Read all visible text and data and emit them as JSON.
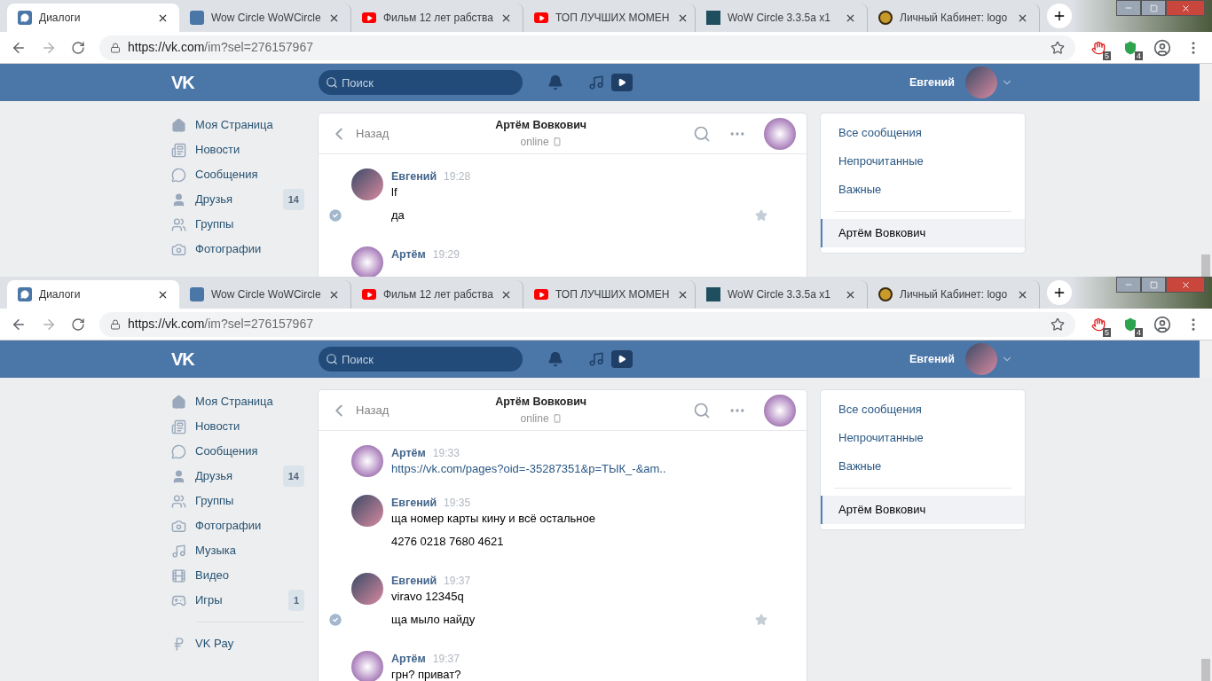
{
  "screens": [
    {
      "tabs": [
        {
          "label": "Диалоги",
          "selected": true
        },
        {
          "label": "Wow Circle WoWCircle",
          "selected": false
        },
        {
          "label": "Фильм 12 лет рабства",
          "selected": false
        },
        {
          "label": "ТОП ЛУЧШИХ МОМЕН",
          "selected": false
        },
        {
          "label": "WoW Circle 3.3.5a x1",
          "selected": false
        },
        {
          "label": "Личный Кабинет: logo",
          "selected": false
        }
      ],
      "address": {
        "host": "https://vk.com",
        "path": "/im?sel=276157967"
      },
      "extensions": [
        {
          "kind": "block",
          "badge": "5"
        },
        {
          "kind": "shield",
          "badge": "4"
        }
      ],
      "header": {
        "logo": "VK",
        "search_placeholder": "Поиск",
        "user": "Евгений"
      },
      "sidebar": [
        {
          "label": "Моя Страница"
        },
        {
          "label": "Новости"
        },
        {
          "label": "Сообщения"
        },
        {
          "label": "Друзья",
          "count": "14"
        },
        {
          "label": "Группы"
        },
        {
          "label": "Фотографии"
        }
      ],
      "dialog": {
        "back": "Назад",
        "title": "Артём Вовкович",
        "status": "online",
        "messages": [
          {
            "kind": "user",
            "author": "Евгений",
            "time": "19:28",
            "lines": [
              {
                "kind": "text",
                "text": "lf",
                "selected": false
              },
              {
                "kind": "text",
                "text": "да",
                "selected": true
              }
            ]
          },
          {
            "kind": "contact",
            "author": "Артём",
            "time": "19:29"
          }
        ]
      },
      "filters": [
        {
          "label": "Все сообщения",
          "selected": false
        },
        {
          "label": "Непрочитанные",
          "selected": false
        },
        {
          "label": "Важные",
          "selected": false
        },
        {
          "label": "Артём Вовкович",
          "selected": true
        }
      ]
    },
    {
      "tabs": [
        {
          "label": "Диалоги",
          "selected": true
        },
        {
          "label": "Wow Circle WoWCircle",
          "selected": false
        },
        {
          "label": "Фильм 12 лет рабства",
          "selected": false
        },
        {
          "label": "ТОП ЛУЧШИХ МОМЕН",
          "selected": false
        },
        {
          "label": "WoW Circle 3.3.5a x1",
          "selected": false
        },
        {
          "label": "Личный Кабинет: logo",
          "selected": false
        }
      ],
      "address": {
        "host": "https://vk.com",
        "path": "/im?sel=276157967"
      },
      "extensions": [
        {
          "kind": "block",
          "badge": "5"
        },
        {
          "kind": "shield",
          "badge": "4"
        }
      ],
      "header": {
        "logo": "VK",
        "search_placeholder": "Поиск",
        "user": "Евгений"
      },
      "sidebar": [
        {
          "label": "Моя Страница"
        },
        {
          "label": "Новости"
        },
        {
          "label": "Сообщения"
        },
        {
          "label": "Друзья",
          "count": "14"
        },
        {
          "label": "Группы"
        },
        {
          "label": "Фотографии"
        },
        {
          "label": "Музыка"
        },
        {
          "label": "Видео"
        },
        {
          "label": "Игры",
          "count": "1"
        },
        {
          "label": "VK Pay",
          "divider_before": true
        }
      ],
      "dialog": {
        "back": "Назад",
        "title": "Артём Вовкович",
        "status": "online",
        "messages": [
          {
            "kind": "contact",
            "author": "Артём",
            "time": "19:33",
            "lines": [
              {
                "kind": "link",
                "text": "https://vk.com/pages?oid=-35287351&p=ТЫК_-&am..",
                "selected": false
              }
            ]
          },
          {
            "kind": "user",
            "author": "Евгений",
            "time": "19:35",
            "lines": [
              {
                "kind": "text",
                "text": "ща номер карты кину и всё остальное",
                "selected": false
              },
              {
                "kind": "text",
                "text": "4276 0218 7680 4621",
                "selected": false
              }
            ]
          },
          {
            "kind": "user",
            "author": "Евгений",
            "time": "19:37",
            "lines": [
              {
                "kind": "text",
                "text": "viravo 12345q",
                "selected": false
              },
              {
                "kind": "text",
                "text": "ща мыло найду",
                "selected": true
              }
            ]
          },
          {
            "kind": "contact",
            "author": "Артём",
            "time": "19:37",
            "lines": [
              {
                "kind": "text",
                "text": "грн? приват?",
                "selected": false
              }
            ]
          }
        ]
      },
      "filters": [
        {
          "label": "Все сообщения",
          "selected": false
        },
        {
          "label": "Непрочитанные",
          "selected": false
        },
        {
          "label": "Важные",
          "selected": false
        },
        {
          "label": "Артём Вовкович",
          "selected": true
        }
      ]
    }
  ]
}
